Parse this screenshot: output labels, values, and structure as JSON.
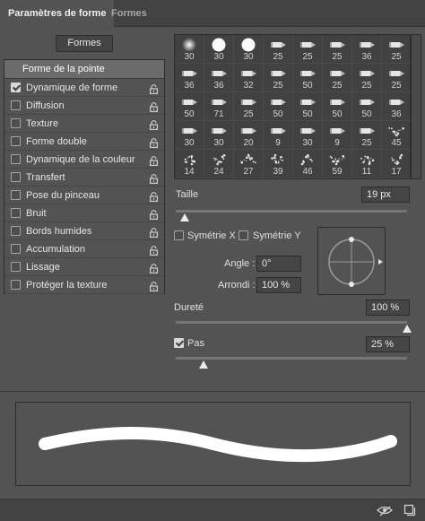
{
  "tabs": {
    "active": "Paramètres de forme",
    "inactive": "Formes"
  },
  "formes_button": "Formes",
  "options": {
    "header": "Forme de la pointe",
    "items": [
      {
        "label": "Dynamique de forme",
        "checked": true
      },
      {
        "label": "Diffusion",
        "checked": false
      },
      {
        "label": "Texture",
        "checked": false
      },
      {
        "label": "Forme double",
        "checked": false
      },
      {
        "label": "Dynamique de la couleur",
        "checked": false
      },
      {
        "label": "Transfert",
        "checked": false
      },
      {
        "label": "Pose du pinceau",
        "checked": false
      },
      {
        "label": "Bruit",
        "checked": false
      },
      {
        "label": "Bords humides",
        "checked": false
      },
      {
        "label": "Accumulation",
        "checked": false
      },
      {
        "label": "Lissage",
        "checked": false
      },
      {
        "label": "Protéger la texture",
        "checked": false
      }
    ]
  },
  "brushes": [
    {
      "size": "30",
      "kind": "soft"
    },
    {
      "size": "30",
      "kind": "hard"
    },
    {
      "size": "30",
      "kind": "hard"
    },
    {
      "size": "25",
      "kind": "tip"
    },
    {
      "size": "25",
      "kind": "tip"
    },
    {
      "size": "25",
      "kind": "tip"
    },
    {
      "size": "36",
      "kind": "tip"
    },
    {
      "size": "25",
      "kind": "tip"
    },
    {
      "size": "36",
      "kind": "tip"
    },
    {
      "size": "36",
      "kind": "tip"
    },
    {
      "size": "32",
      "kind": "tip"
    },
    {
      "size": "25",
      "kind": "tip"
    },
    {
      "size": "50",
      "kind": "tip"
    },
    {
      "size": "25",
      "kind": "tip"
    },
    {
      "size": "25",
      "kind": "tip"
    },
    {
      "size": "25",
      "kind": "tip"
    },
    {
      "size": "50",
      "kind": "tip"
    },
    {
      "size": "71",
      "kind": "tip"
    },
    {
      "size": "25",
      "kind": "tip"
    },
    {
      "size": "50",
      "kind": "tip"
    },
    {
      "size": "50",
      "kind": "tip"
    },
    {
      "size": "50",
      "kind": "tip"
    },
    {
      "size": "50",
      "kind": "tip"
    },
    {
      "size": "36",
      "kind": "tip"
    },
    {
      "size": "30",
      "kind": "tip"
    },
    {
      "size": "30",
      "kind": "tip"
    },
    {
      "size": "20",
      "kind": "tip"
    },
    {
      "size": "9",
      "kind": "tip"
    },
    {
      "size": "30",
      "kind": "tip"
    },
    {
      "size": "9",
      "kind": "tip"
    },
    {
      "size": "25",
      "kind": "tip"
    },
    {
      "size": "45",
      "kind": "spatter"
    },
    {
      "size": "14",
      "kind": "spatter"
    },
    {
      "size": "24",
      "kind": "spatter"
    },
    {
      "size": "27",
      "kind": "spatter"
    },
    {
      "size": "39",
      "kind": "spatter"
    },
    {
      "size": "46",
      "kind": "spatter"
    },
    {
      "size": "59",
      "kind": "spatter"
    },
    {
      "size": "11",
      "kind": "spatter"
    },
    {
      "size": "17",
      "kind": "spatter"
    }
  ],
  "size": {
    "label": "Taille",
    "value": "19 px",
    "slider_fraction": 0.04
  },
  "symmetry": {
    "x_label": "Symétrie X",
    "y_label": "Symétrie Y",
    "x_checked": false,
    "y_checked": false
  },
  "angle": {
    "label": "Angle :",
    "value": "0°"
  },
  "roundness": {
    "label": "Arrondi :",
    "value": "100 %"
  },
  "hardness": {
    "label": "Dureté",
    "value": "100 %",
    "slider_fraction": 1.0
  },
  "spacing": {
    "label": "Pas",
    "value": "25 %",
    "checked": true,
    "slider_fraction": 0.12
  },
  "footer": {
    "icons": [
      "eye-brush-icon",
      "new-preset-icon"
    ]
  }
}
